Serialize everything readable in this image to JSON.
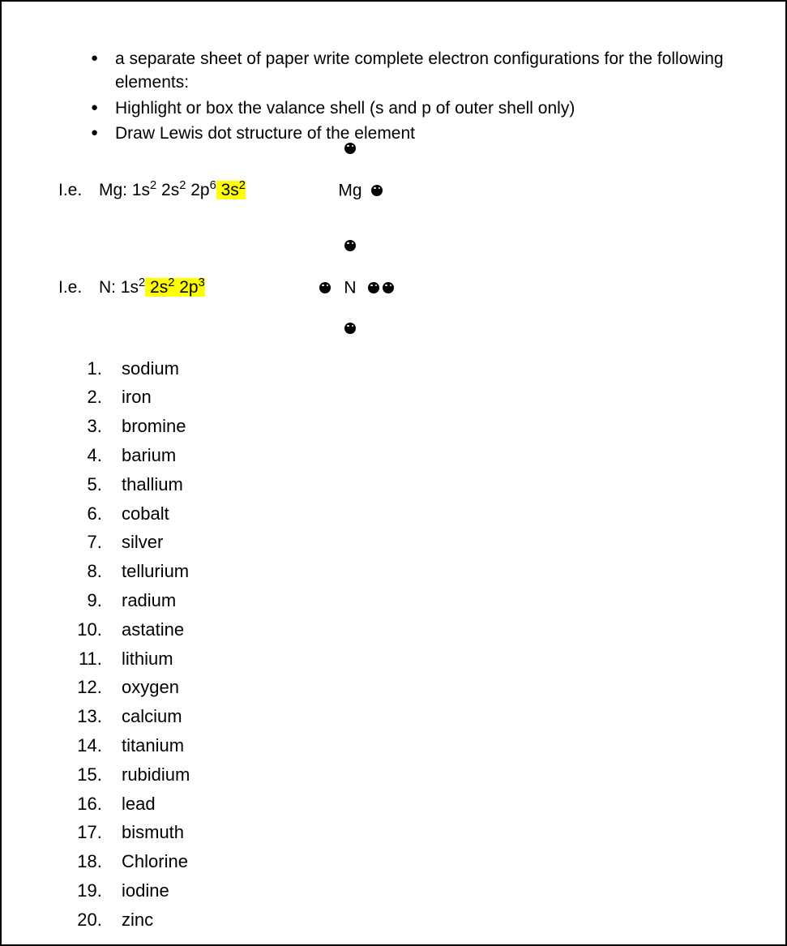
{
  "instructions": [
    "a separate sheet of paper write complete electron configurations for the following elements:",
    "Highlight or box the valance shell (s and p of outer shell only)",
    "Draw Lewis dot structure of the element"
  ],
  "examples": {
    "label": "I.e.",
    "mg": {
      "prefix": "Mg: ",
      "segments": [
        {
          "base": "1s",
          "exp": "2",
          "hl": false
        },
        {
          "base": " 2s",
          "exp": "2",
          "hl": false
        },
        {
          "base": " 2p",
          "exp": "6",
          "hl": false
        },
        {
          "base": " 3s",
          "exp": "2",
          "hl": true
        }
      ],
      "symbol": "Mg"
    },
    "n": {
      "prefix": "N: ",
      "segments": [
        {
          "base": "1s",
          "exp": "2",
          "hl": false
        },
        {
          "base": " 2s",
          "exp": "2",
          "hl": true
        },
        {
          "base": " 2p",
          "exp": "3",
          "hl": true
        }
      ],
      "symbol": "N"
    }
  },
  "elements": [
    "sodium",
    "iron",
    "bromine",
    "barium",
    "thallium",
    "cobalt",
    "silver",
    " tellurium",
    "radium",
    "astatine",
    "lithium",
    "oxygen",
    "calcium",
    "titanium",
    "rubidium",
    "lead",
    "bismuth",
    "Chlorine",
    "iodine",
    "zinc"
  ]
}
